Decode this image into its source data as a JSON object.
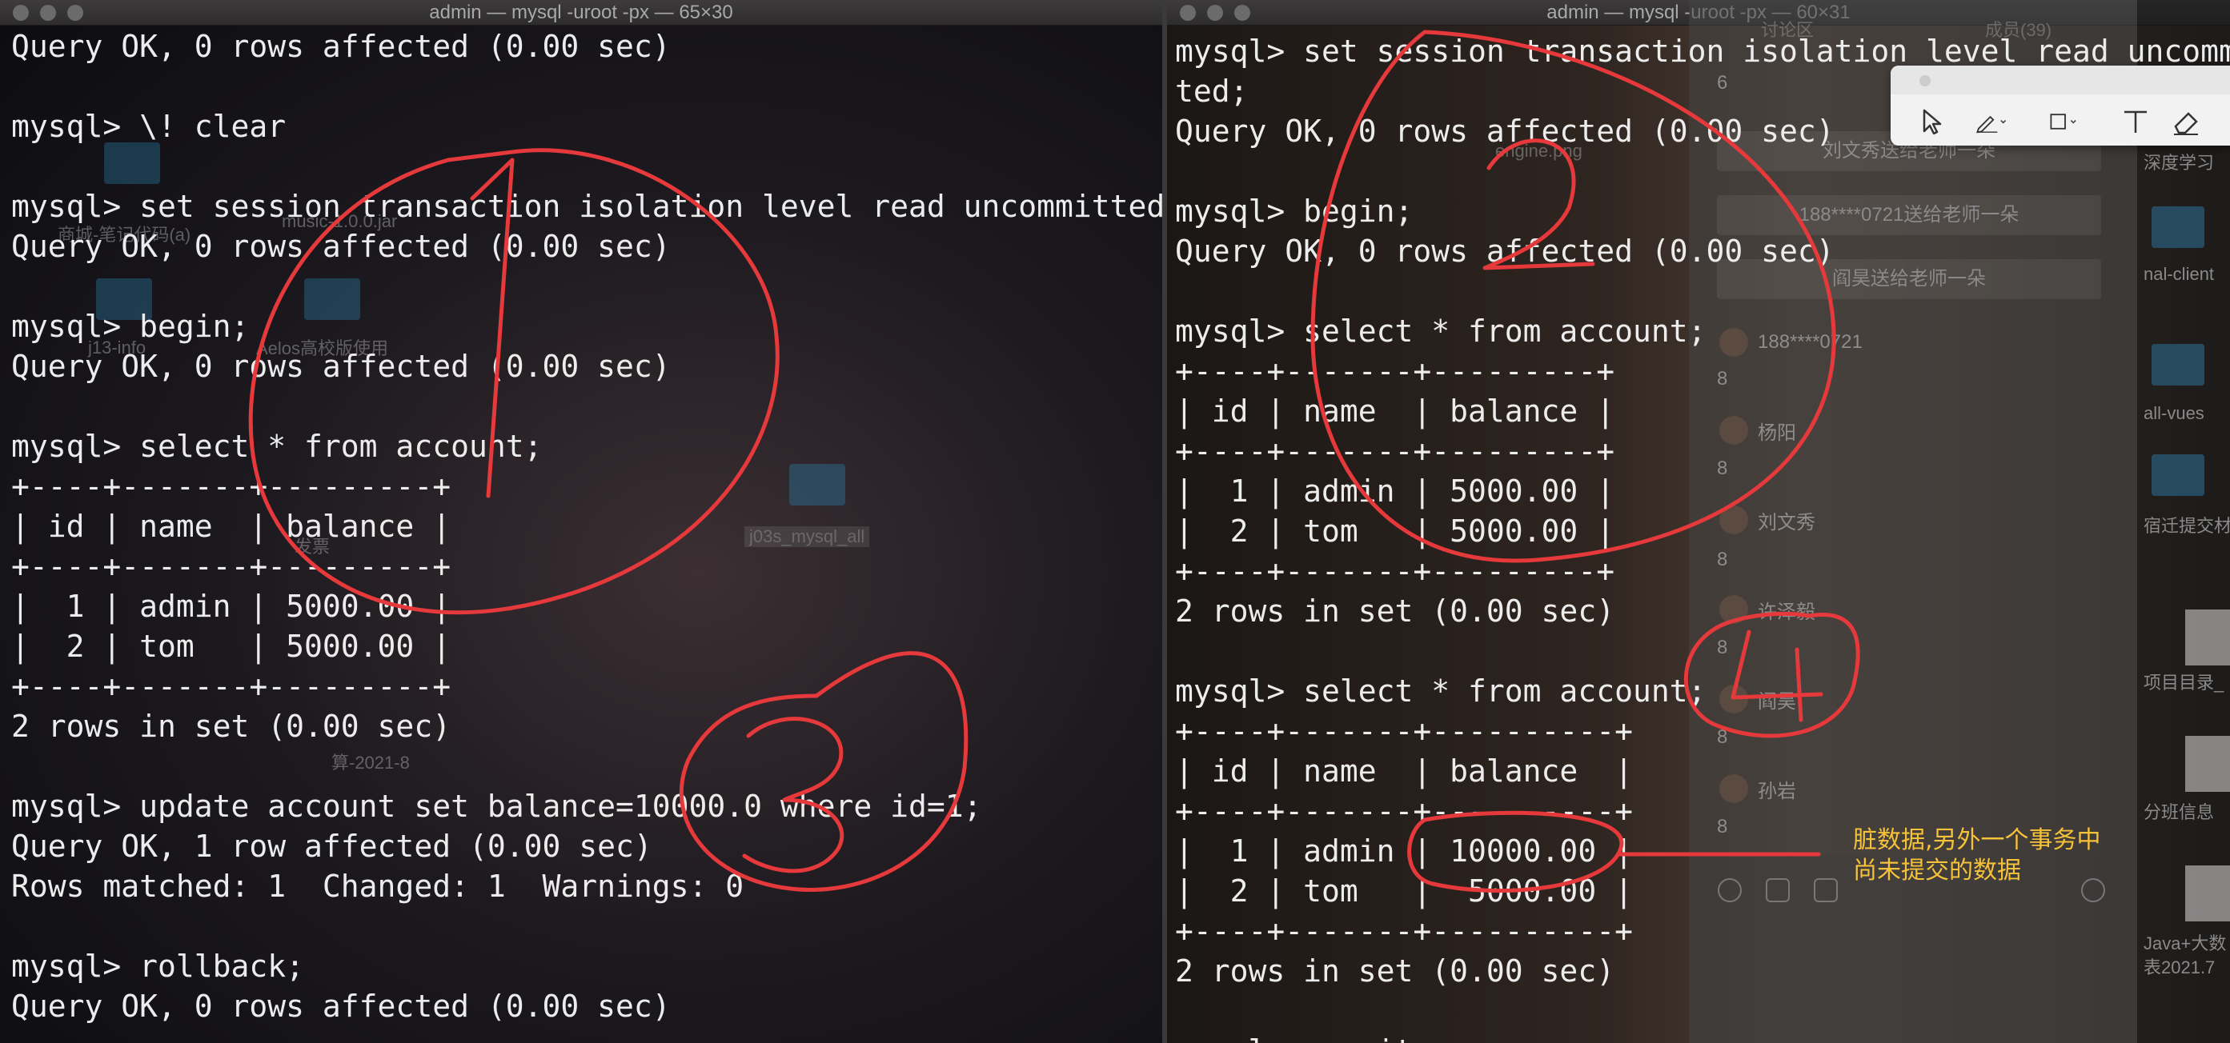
{
  "left_window": {
    "title": "admin — mysql -uroot -px — 65×30",
    "lines": [
      "Query OK, 0 rows affected (0.00 sec)",
      "",
      "mysql> \\! clear",
      "",
      "mysql> set session transaction isolation level read uncommitted;",
      "Query OK, 0 rows affected (0.00 sec)",
      "",
      "mysql> begin;",
      "Query OK, 0 rows affected (0.00 sec)",
      "",
      "mysql> select * from account;",
      "+----+-------+---------+",
      "| id | name  | balance |",
      "+----+-------+---------+",
      "|  1 | admin | 5000.00 |",
      "|  2 | tom   | 5000.00 |",
      "+----+-------+---------+",
      "2 rows in set (0.00 sec)",
      "",
      "mysql> update account set balance=10000.0 where id=1;",
      "Query OK, 1 row affected (0.00 sec)",
      "Rows matched: 1  Changed: 1  Warnings: 0",
      "",
      "mysql> rollback;",
      "Query OK, 0 rows affected (0.00 sec)"
    ]
  },
  "right_window": {
    "title": "admin — mysql -uroot -px — 60×31",
    "lines": [
      "mysql> set session transaction isolation level read uncommit",
      "ted;",
      "Query OK, 0 rows affected (0.00 sec)",
      "",
      "mysql> begin;",
      "Query OK, 0 rows affected (0.00 sec)",
      "",
      "mysql> select * from account;",
      "+----+-------+---------+",
      "| id | name  | balance |",
      "+----+-------+---------+",
      "|  1 | admin | 5000.00 |",
      "|  2 | tom   | 5000.00 |",
      "+----+-------+---------+",
      "2 rows in set (0.00 sec)",
      "",
      "mysql> select * from account;",
      "+----+-------+----------+",
      "| id | name  | balance  |",
      "+----+-------+----------+",
      "|  1 | admin | 10000.00 |",
      "|  2 | tom   |  5000.00 |",
      "+----+-------+----------+",
      "2 rows in set (0.00 sec)",
      "",
      "mysql> commit;"
    ]
  },
  "annotations": {
    "markers": [
      "1",
      "2",
      "3",
      "4"
    ],
    "note_line1": "脏数据,另外一个事务中",
    "note_line2": "尚未提交的数据",
    "color": "#e5393b",
    "note_color": "#f5c23a"
  },
  "desktop": {
    "labels": [
      "商城-笔记代码(a)",
      "music-1.0.0.jar",
      "j13-info",
      "Aelos高校版使用",
      "发票",
      "j03s_mysql_all",
      "算-2021-8",
      "engine.png"
    ]
  },
  "chat": {
    "header_left": "讨论区",
    "header_right": "成员(39)",
    "messages": [
      "刘文秀送给老师一朵",
      "188****0721送给老师一朵",
      "阎昊送给老师一朵"
    ],
    "users": [
      "188****0721",
      "杨阳",
      "刘文秀",
      "许泽毅",
      "阎昊",
      "孙岩"
    ],
    "count": "8",
    "first_count": "6"
  },
  "right_strip": {
    "labels": [
      "深度学习",
      "nal-client",
      "all-vues",
      "宿迁提交材",
      "项目目录_",
      "分班信息",
      "Java+大数",
      "表2021.7"
    ]
  },
  "toolbar": {
    "tools": [
      "select-arrow-icon",
      "pen-icon",
      "rectangle-icon",
      "text-icon",
      "eraser-icon"
    ]
  }
}
